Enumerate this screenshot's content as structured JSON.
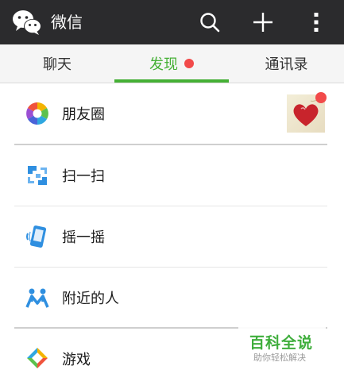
{
  "app": {
    "title": "微信"
  },
  "tabs": [
    {
      "label": "聊天",
      "active": false,
      "badge": false
    },
    {
      "label": "发现",
      "active": true,
      "badge": true
    },
    {
      "label": "通讯录",
      "active": false,
      "badge": false
    }
  ],
  "list": [
    {
      "label": "朋友圈",
      "icon": "moments-icon",
      "has_thumbnail": true,
      "thumbnail_badge": true
    },
    {
      "label": "扫一扫",
      "icon": "scan-icon"
    },
    {
      "label": "摇一摇",
      "icon": "shake-icon"
    },
    {
      "label": "附近的人",
      "icon": "nearby-people-icon"
    },
    {
      "label": "游戏",
      "icon": "games-icon"
    }
  ],
  "watermark": {
    "main": "百科全说",
    "sub": "助你轻松解决"
  },
  "colors": {
    "topbar": "#2b2b2d",
    "accent": "#45b035",
    "badge": "#f24a4a"
  }
}
